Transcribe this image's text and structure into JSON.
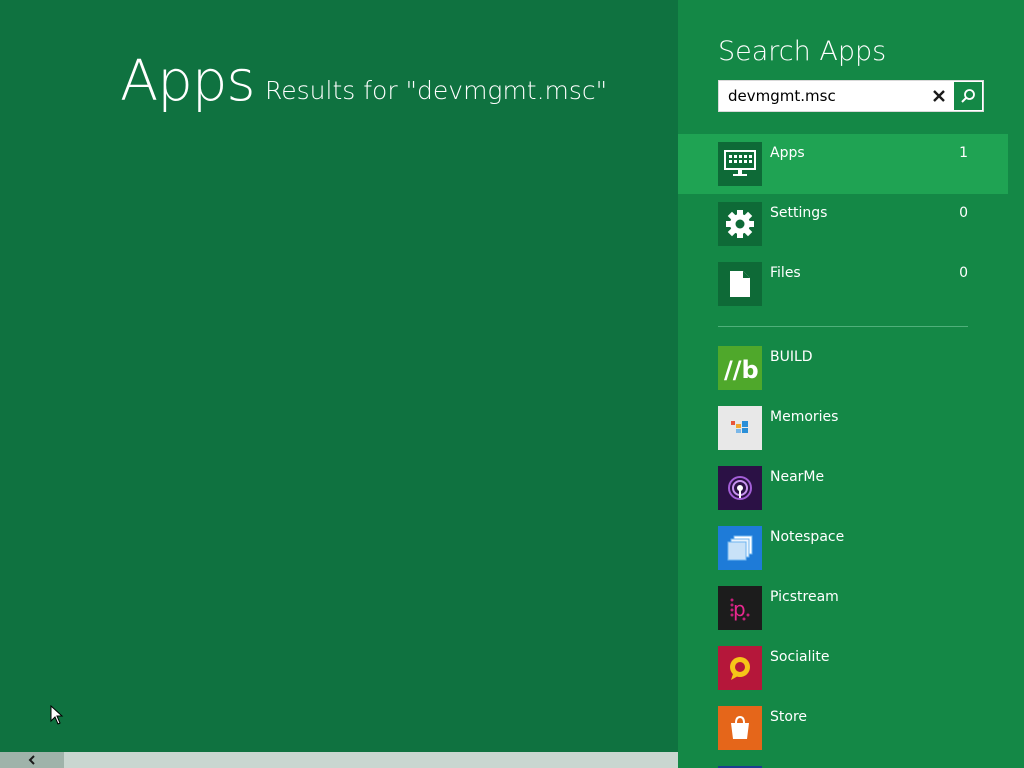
{
  "results": {
    "title": "Apps",
    "results_for": "Results for \"devmgmt.msc\""
  },
  "pane": {
    "title": "Search Apps",
    "search": {
      "value": "devmgmt.msc",
      "placeholder": ""
    },
    "scopes": [
      {
        "label": "Apps",
        "count": "1",
        "icon": "monitor-keyboard-icon",
        "selected": true
      },
      {
        "label": "Settings",
        "count": "0",
        "icon": "gear-icon",
        "selected": false
      },
      {
        "label": "Files",
        "count": "0",
        "icon": "document-icon",
        "selected": false
      }
    ],
    "apps": [
      {
        "label": "BUILD",
        "icon": "build-icon",
        "color": "#4fa82b"
      },
      {
        "label": "Memories",
        "icon": "memories-icon",
        "color": "#e8e8e8"
      },
      {
        "label": "NearMe",
        "icon": "nearme-icon",
        "color": "#2b1145"
      },
      {
        "label": "Notespace",
        "icon": "notespace-icon",
        "color": "#1e7bd8"
      },
      {
        "label": "Picstream",
        "icon": "picstream-icon",
        "color": "#1c1c1c"
      },
      {
        "label": "Socialite",
        "icon": "socialite-icon",
        "color": "#b5173a"
      },
      {
        "label": "Store",
        "icon": "store-icon",
        "color": "#e5661a"
      }
    ]
  },
  "colors": {
    "results_bg": "#0f7240",
    "pane_bg": "#148846",
    "selected_scope_bg": "#1fa353"
  }
}
